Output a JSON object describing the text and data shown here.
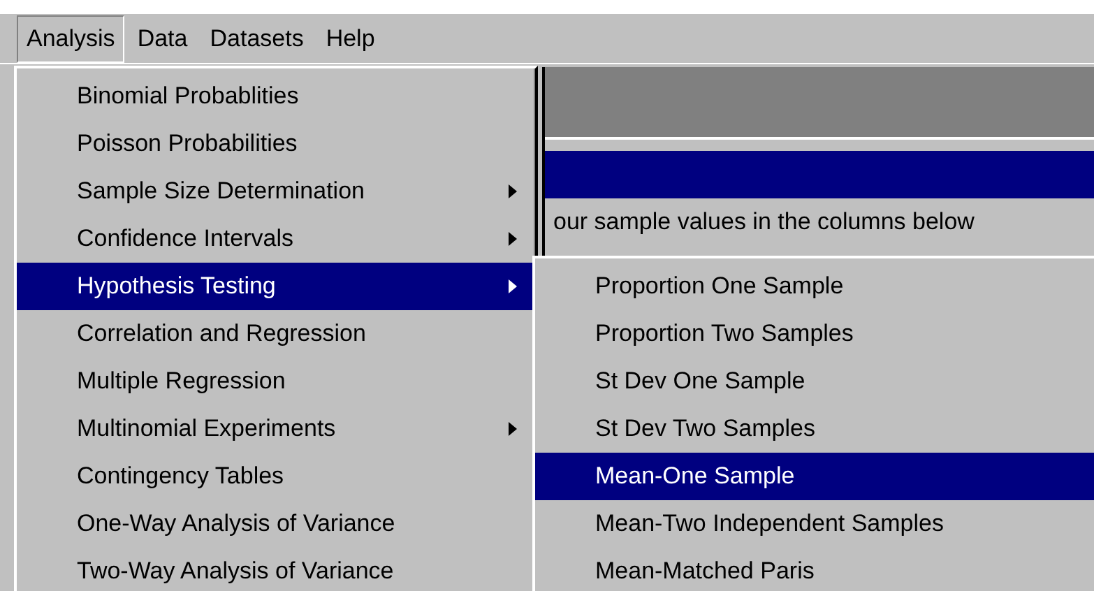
{
  "menubar": [
    {
      "label": "Analysis",
      "selected": true
    },
    {
      "label": "Data",
      "selected": false
    },
    {
      "label": "Datasets",
      "selected": false
    },
    {
      "label": "Help",
      "selected": false
    }
  ],
  "background_window": {
    "instruction": "our sample values in the columns below"
  },
  "analysis_menu": [
    {
      "label": "Binomial Probablities",
      "selected": false,
      "has_submenu": false
    },
    {
      "label": "Poisson Probabilities",
      "selected": false,
      "has_submenu": false
    },
    {
      "label": "Sample Size Determination",
      "selected": false,
      "has_submenu": true
    },
    {
      "label": "Confidence Intervals",
      "selected": false,
      "has_submenu": true
    },
    {
      "label": "Hypothesis Testing",
      "selected": true,
      "has_submenu": true
    },
    {
      "label": "Correlation and Regression",
      "selected": false,
      "has_submenu": false
    },
    {
      "label": "Multiple Regression",
      "selected": false,
      "has_submenu": false
    },
    {
      "label": "Multinomial Experiments",
      "selected": false,
      "has_submenu": true
    },
    {
      "label": "Contingency Tables",
      "selected": false,
      "has_submenu": false
    },
    {
      "label": "One-Way Analysis of Variance",
      "selected": false,
      "has_submenu": false
    },
    {
      "label": "Two-Way Analysis of Variance",
      "selected": false,
      "has_submenu": false
    }
  ],
  "hypothesis_submenu": [
    {
      "label": "Proportion One Sample",
      "selected": false
    },
    {
      "label": "Proportion Two Samples",
      "selected": false
    },
    {
      "label": "St Dev One Sample",
      "selected": false
    },
    {
      "label": "St Dev Two Samples",
      "selected": false
    },
    {
      "label": "Mean-One Sample",
      "selected": true
    },
    {
      "label": "Mean-Two Independent Samples",
      "selected": false
    },
    {
      "label": "Mean-Matched Paris",
      "selected": false
    }
  ]
}
